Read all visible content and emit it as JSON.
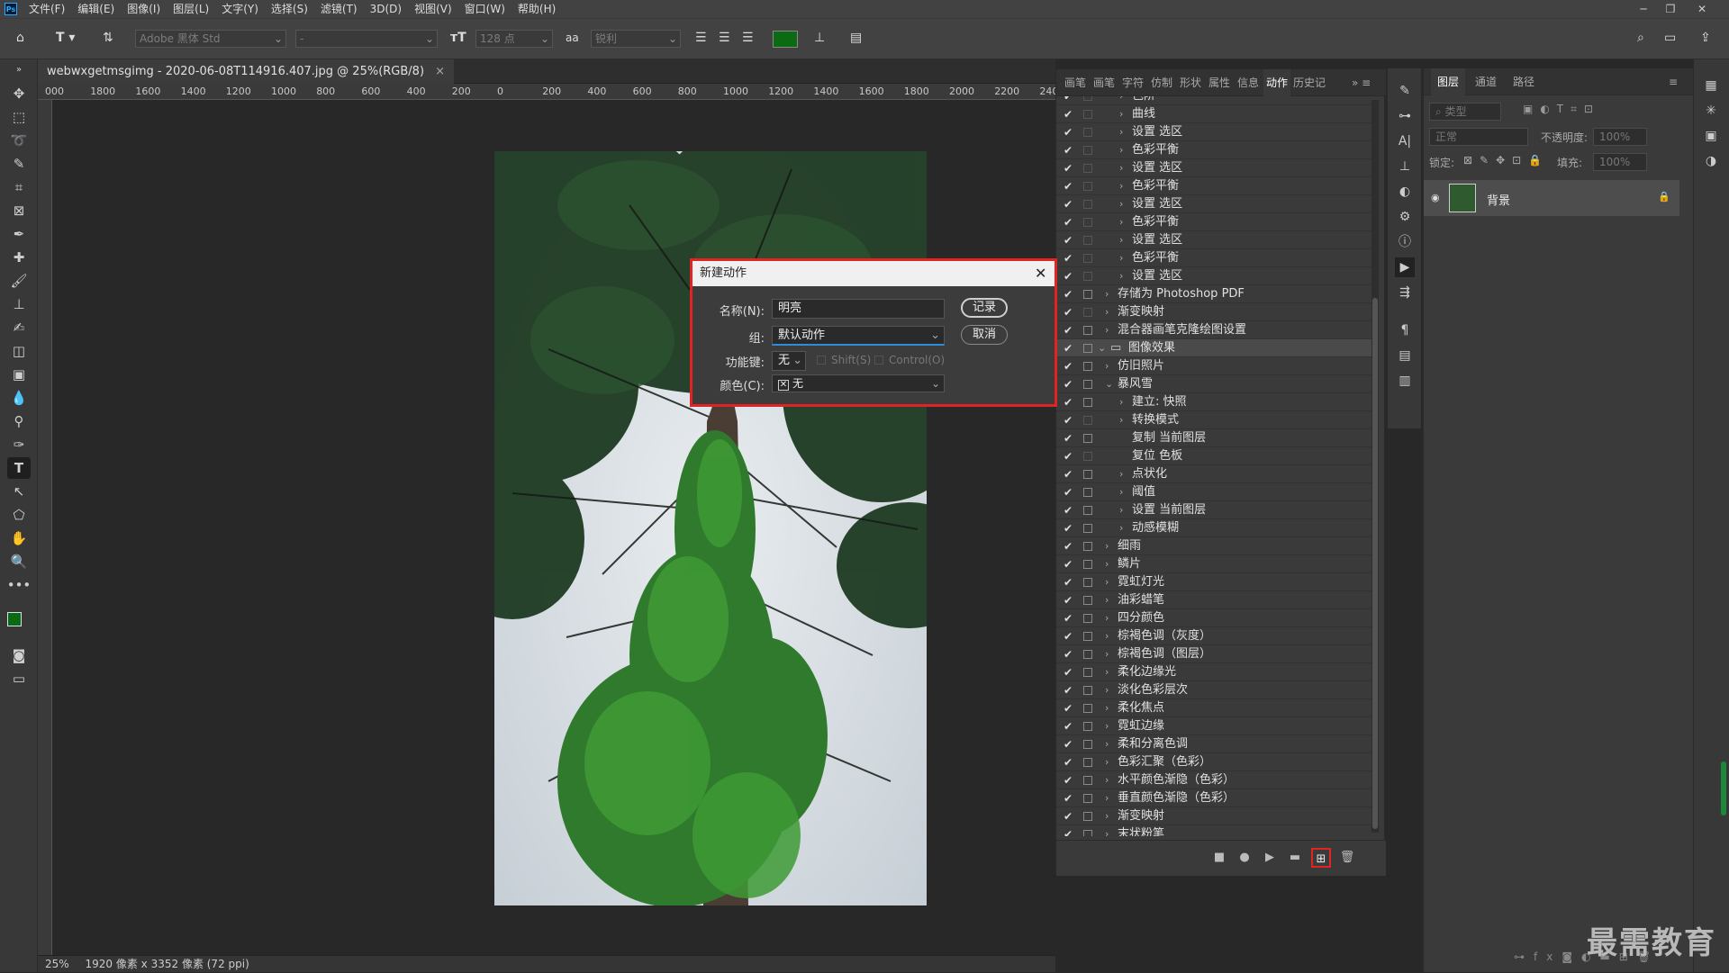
{
  "app": {
    "logo": "Ps"
  },
  "menu": [
    "文件(F)",
    "编辑(E)",
    "图像(I)",
    "图层(L)",
    "文字(Y)",
    "选择(S)",
    "滤镜(T)",
    "3D(D)",
    "视图(V)",
    "窗口(W)",
    "帮助(H)"
  ],
  "options": {
    "font_family": "Adobe 黑体 Std",
    "font_style": "-",
    "font_size": "128 点",
    "antialias_icon": "aa",
    "antialias": "锐利",
    "text_color": "#0b6b12"
  },
  "document": {
    "tab_title": "webwxgetmsgimg - 2020-06-08T114916.407.jpg @ 25%(RGB/8)",
    "tab_close": "×",
    "ruler_labels": [
      "000",
      "1800",
      "1600",
      "1400",
      "1200",
      "1000",
      "800",
      "600",
      "400",
      "200",
      "0",
      "200",
      "400",
      "600",
      "800",
      "1000",
      "1200",
      "1400",
      "1600",
      "1800",
      "2000",
      "2200",
      "240"
    ],
    "zoom": "25%",
    "doc_info": "1920 像素 x 3352 像素 (72 ppi)"
  },
  "actions_panel": {
    "tabs": [
      "画笔",
      "画笔",
      "字符",
      "仿制",
      "形状",
      "属性",
      "信息",
      "动作",
      "历史记"
    ],
    "active_tab": "动作",
    "rows": [
      {
        "indent": 2,
        "label": "色阶",
        "dlg": "empty",
        "exp": "›"
      },
      {
        "indent": 2,
        "label": "曲线",
        "dlg": "empty",
        "exp": "›"
      },
      {
        "indent": 2,
        "label": "设置 选区",
        "dlg": "empty",
        "exp": "›"
      },
      {
        "indent": 2,
        "label": "色彩平衡",
        "dlg": "empty",
        "exp": "›"
      },
      {
        "indent": 2,
        "label": "设置 选区",
        "dlg": "empty",
        "exp": "›"
      },
      {
        "indent": 2,
        "label": "色彩平衡",
        "dlg": "empty",
        "exp": "›"
      },
      {
        "indent": 2,
        "label": "设置 选区",
        "dlg": "empty",
        "exp": "›"
      },
      {
        "indent": 2,
        "label": "色彩平衡",
        "dlg": "empty",
        "exp": "›"
      },
      {
        "indent": 2,
        "label": "设置 选区",
        "dlg": "empty",
        "exp": "›"
      },
      {
        "indent": 2,
        "label": "色彩平衡",
        "dlg": "empty",
        "exp": "›"
      },
      {
        "indent": 2,
        "label": "设置 选区",
        "dlg": "empty",
        "exp": "›"
      },
      {
        "indent": 1,
        "label": "存储为 Photoshop PDF",
        "dlg": "on",
        "exp": "›"
      },
      {
        "indent": 1,
        "label": "渐变映射",
        "dlg": "empty",
        "exp": "›"
      },
      {
        "indent": 1,
        "label": "混合器画笔克隆绘图设置",
        "dlg": "on",
        "exp": "›"
      },
      {
        "indent": 0,
        "label": "图像效果",
        "dlg": "on",
        "exp": "⌄",
        "folder": true,
        "sel": true
      },
      {
        "indent": 1,
        "label": "仿旧照片",
        "dlg": "on",
        "exp": "›"
      },
      {
        "indent": 1,
        "label": "暴风雪",
        "dlg": "on",
        "exp": "⌄"
      },
      {
        "indent": 2,
        "label": "建立: 快照",
        "dlg": "on",
        "exp": "›"
      },
      {
        "indent": 2,
        "label": "转换模式",
        "dlg": "empty",
        "exp": "›"
      },
      {
        "indent": 2,
        "label": "复制 当前图层",
        "dlg": "on",
        "exp": ""
      },
      {
        "indent": 2,
        "label": "复位 色板",
        "dlg": "empty",
        "exp": ""
      },
      {
        "indent": 2,
        "label": "点状化",
        "dlg": "on",
        "exp": "›"
      },
      {
        "indent": 2,
        "label": "阈值",
        "dlg": "on",
        "exp": "›"
      },
      {
        "indent": 2,
        "label": "设置 当前图层",
        "dlg": "on",
        "exp": "›"
      },
      {
        "indent": 2,
        "label": "动感模糊",
        "dlg": "on",
        "exp": "›"
      },
      {
        "indent": 1,
        "label": "细雨",
        "dlg": "on",
        "exp": "›"
      },
      {
        "indent": 1,
        "label": "鳞片",
        "dlg": "on",
        "exp": "›"
      },
      {
        "indent": 1,
        "label": "霓虹灯光",
        "dlg": "on",
        "exp": "›"
      },
      {
        "indent": 1,
        "label": "油彩蜡笔",
        "dlg": "on",
        "exp": "›"
      },
      {
        "indent": 1,
        "label": "四分颜色",
        "dlg": "on",
        "exp": "›"
      },
      {
        "indent": 1,
        "label": "棕褐色调（灰度）",
        "dlg": "on",
        "exp": "›"
      },
      {
        "indent": 1,
        "label": "棕褐色调（图层）",
        "dlg": "on",
        "exp": "›"
      },
      {
        "indent": 1,
        "label": "柔化边缘光",
        "dlg": "on",
        "exp": "›"
      },
      {
        "indent": 1,
        "label": "淡化色彩层次",
        "dlg": "on",
        "exp": "›"
      },
      {
        "indent": 1,
        "label": "柔化焦点",
        "dlg": "on",
        "exp": "›"
      },
      {
        "indent": 1,
        "label": "霓虹边缘",
        "dlg": "on",
        "exp": "›"
      },
      {
        "indent": 1,
        "label": "柔和分离色调",
        "dlg": "on",
        "exp": "›"
      },
      {
        "indent": 1,
        "label": "色彩汇聚（色彩）",
        "dlg": "on",
        "exp": "›"
      },
      {
        "indent": 1,
        "label": "水平颜色渐隐（色彩）",
        "dlg": "on",
        "exp": "›"
      },
      {
        "indent": 1,
        "label": "垂直颜色渐隐（色彩）",
        "dlg": "on",
        "exp": "›"
      },
      {
        "indent": 1,
        "label": "渐变映射",
        "dlg": "on",
        "exp": "›"
      },
      {
        "indent": 1,
        "label": "末状粉笔",
        "dlg": "on",
        "exp": "›"
      }
    ],
    "footer_icons": [
      "stop-icon",
      "record-icon",
      "play-icon",
      "folder-icon",
      "new-action-icon",
      "trash-icon"
    ]
  },
  "layers_panel": {
    "tabs": [
      "图层",
      "通道",
      "路径"
    ],
    "filter_placeholder": "类型",
    "blend_mode": "正常",
    "opacity_label": "不透明度:",
    "opacity_value": "100%",
    "lock_label": "锁定:",
    "fill_label": "填充:",
    "fill_value": "100%",
    "layers": [
      {
        "name": "背景",
        "locked": true,
        "visible": true
      }
    ]
  },
  "dialog": {
    "title": "新建动作",
    "name_label": "名称(N):",
    "name_value": "明亮",
    "set_label": "组:",
    "set_value": "默认动作",
    "fkey_label": "功能键:",
    "fkey_value": "无",
    "shift_label": "Shift(S)",
    "control_label": "Control(O)",
    "color_label": "颜色(C):",
    "color_value": "无",
    "record_label": "记录",
    "cancel_label": "取消"
  },
  "watermark": "最需教育"
}
